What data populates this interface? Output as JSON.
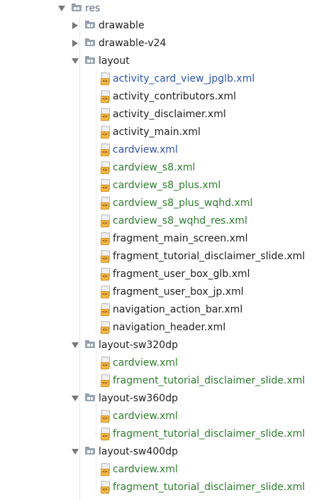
{
  "tree": {
    "rows": [
      {
        "label": "res",
        "kind": "folder",
        "arrow": "open",
        "color": "#5b6b7a"
      },
      {
        "label": "drawable",
        "kind": "folder",
        "arrow": "closed",
        "color": "#1f1f1f"
      },
      {
        "label": "drawable-v24",
        "kind": "folder",
        "arrow": "closed",
        "color": "#1f1f1f"
      },
      {
        "label": "layout",
        "kind": "folder",
        "arrow": "open",
        "color": "#1f1f1f"
      },
      {
        "label": "activity_card_view_jpglb.xml",
        "kind": "xml-file",
        "color": "#2f54a8"
      },
      {
        "label": "activity_contributors.xml",
        "kind": "xml-file",
        "color": "#1f1f1f"
      },
      {
        "label": "activity_disclaimer.xml",
        "kind": "xml-file",
        "color": "#1f1f1f"
      },
      {
        "label": "activity_main.xml",
        "kind": "xml-file",
        "color": "#1f1f1f"
      },
      {
        "label": "cardview.xml",
        "kind": "xml-file",
        "color": "#2f54a8"
      },
      {
        "label": "cardview_s8.xml",
        "kind": "xml-file",
        "color": "#2f7d2f"
      },
      {
        "label": "cardview_s8_plus.xml",
        "kind": "xml-file",
        "color": "#2f7d2f"
      },
      {
        "label": "cardview_s8_plus_wqhd.xml",
        "kind": "xml-file",
        "color": "#2f7d2f"
      },
      {
        "label": "cardview_s8_wqhd_res.xml",
        "kind": "xml-file",
        "color": "#2f7d2f"
      },
      {
        "label": "fragment_main_screen.xml",
        "kind": "xml-file",
        "color": "#1f1f1f"
      },
      {
        "label": "fragment_tutorial_disclaimer_slide.xml",
        "kind": "xml-file",
        "color": "#1f1f1f"
      },
      {
        "label": "fragment_user_box_glb.xml",
        "kind": "xml-file",
        "color": "#1f1f1f"
      },
      {
        "label": "fragment_user_box_jp.xml",
        "kind": "xml-file",
        "color": "#1f1f1f"
      },
      {
        "label": "navigation_action_bar.xml",
        "kind": "xml-file",
        "color": "#1f1f1f"
      },
      {
        "label": "navigation_header.xml",
        "kind": "xml-file",
        "color": "#1f1f1f"
      },
      {
        "label": "layout-sw320dp",
        "kind": "folder",
        "arrow": "open",
        "color": "#1f1f1f"
      },
      {
        "label": "cardview.xml",
        "kind": "xml-file",
        "color": "#2f7d2f"
      },
      {
        "label": "fragment_tutorial_disclaimer_slide.xml",
        "kind": "xml-file",
        "color": "#2f7d2f"
      },
      {
        "label": "layout-sw360dp",
        "kind": "folder",
        "arrow": "open",
        "color": "#1f1f1f"
      },
      {
        "label": "cardview.xml",
        "kind": "xml-file",
        "color": "#2f7d2f"
      },
      {
        "label": "fragment_tutorial_disclaimer_slide.xml",
        "kind": "xml-file",
        "color": "#2f7d2f"
      },
      {
        "label": "layout-sw400dp",
        "kind": "folder",
        "arrow": "open",
        "color": "#1f1f1f"
      },
      {
        "label": "cardview.xml",
        "kind": "xml-file",
        "color": "#2f7d2f"
      },
      {
        "label": "fragment_tutorial_disclaimer_slide.xml",
        "kind": "xml-file",
        "color": "#2f7d2f"
      },
      {
        "label": "",
        "kind": "folder",
        "arrow": "closed",
        "color": "#1f1f1f"
      }
    ],
    "file_icon_glyph": "<>"
  }
}
